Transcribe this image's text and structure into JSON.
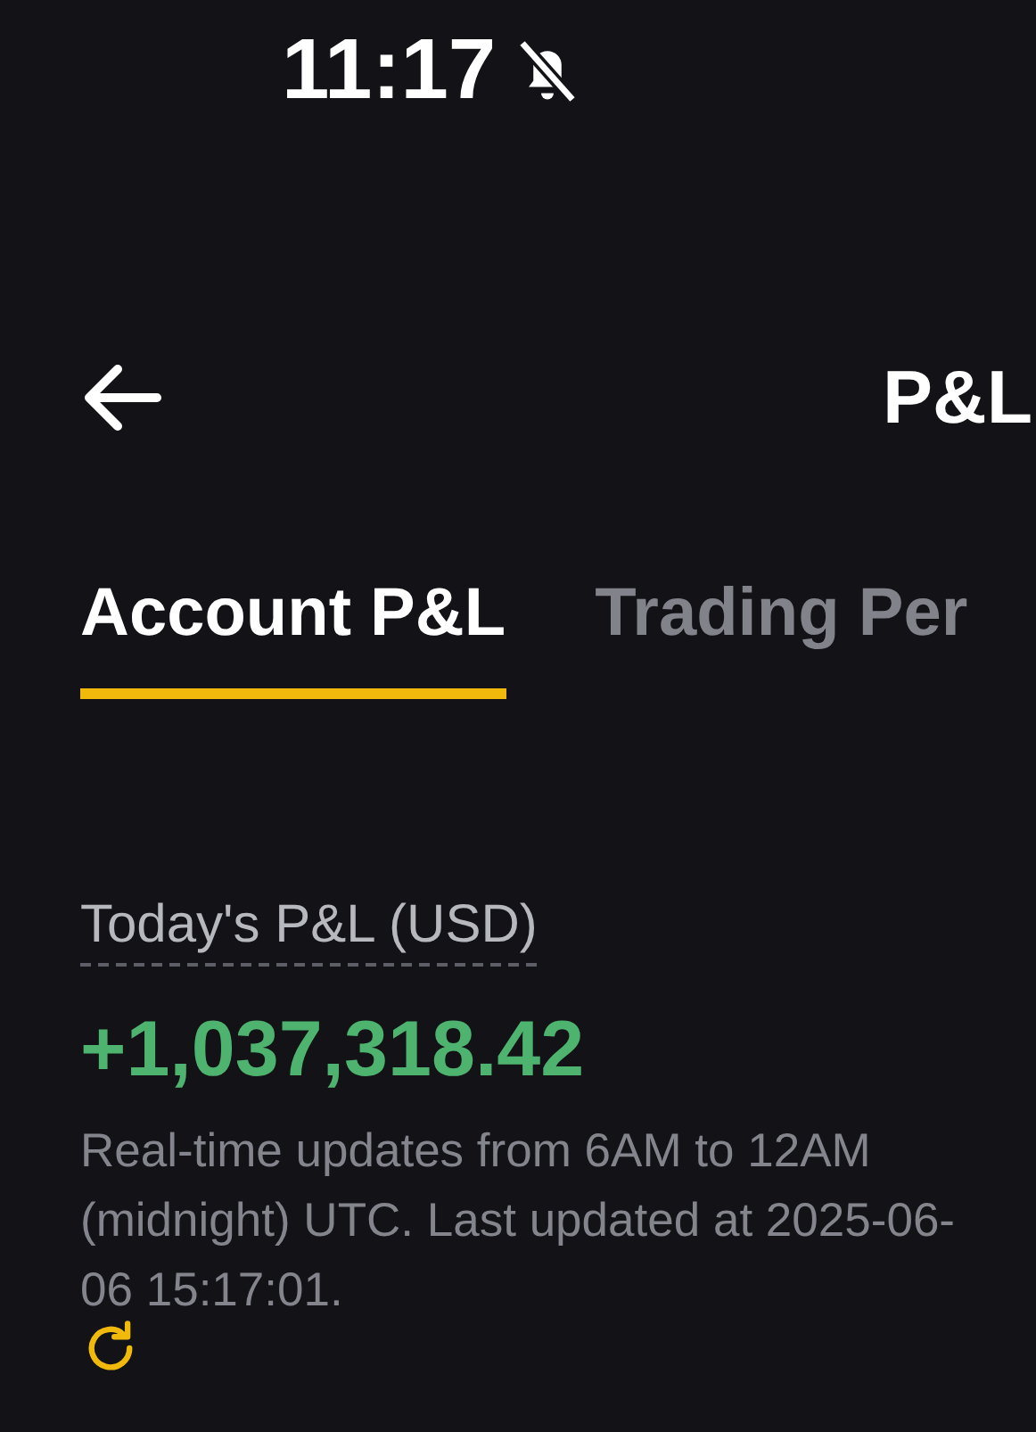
{
  "status_bar": {
    "time": "11:17",
    "silent": true
  },
  "header": {
    "title": "P&L"
  },
  "tabs": [
    {
      "label": "Account P&L",
      "selected": true
    },
    {
      "label": "Trading Per",
      "selected": false
    }
  ],
  "summary": {
    "label": "Today's P&L (USD)",
    "value": "+1,037,318.42",
    "note": "Real-time updates from 6AM to 12AM (midnight) UTC. Last updated at 2025-06-06 15:17:01."
  }
}
